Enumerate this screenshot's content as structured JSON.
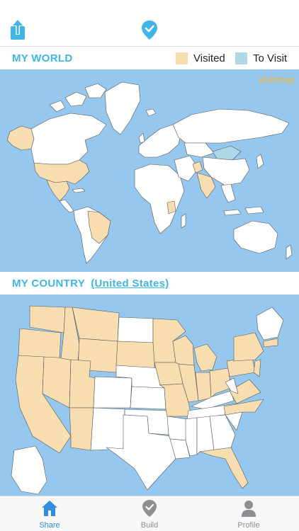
{
  "top_bar": {
    "left_icon": "share-icon",
    "center_icon": "location-pin-icon"
  },
  "world_section": {
    "title": "MY WORLD",
    "legend": [
      {
        "label": "Visited",
        "color": "#f8ddb1"
      },
      {
        "label": "To Visit",
        "color": "#add8e6"
      }
    ],
    "watermark": "visitmap"
  },
  "country_section": {
    "title": "MY COUNTRY",
    "country": "(United States)"
  },
  "colors": {
    "accent": "#3fb6e5",
    "ocean": "#96c7ef",
    "visited": "#f8ddb1",
    "to_visit": "#add8e6",
    "unvisited": "#ffffff",
    "watermark": "#f3b437",
    "tab_active": "#2f8ee0"
  },
  "tab_bar": {
    "tabs": [
      {
        "label": "Share",
        "icon": "home-icon",
        "active": true
      },
      {
        "label": "Build",
        "icon": "pin-check-icon",
        "active": false
      },
      {
        "label": "Profile",
        "icon": "person-icon",
        "active": false
      }
    ]
  }
}
